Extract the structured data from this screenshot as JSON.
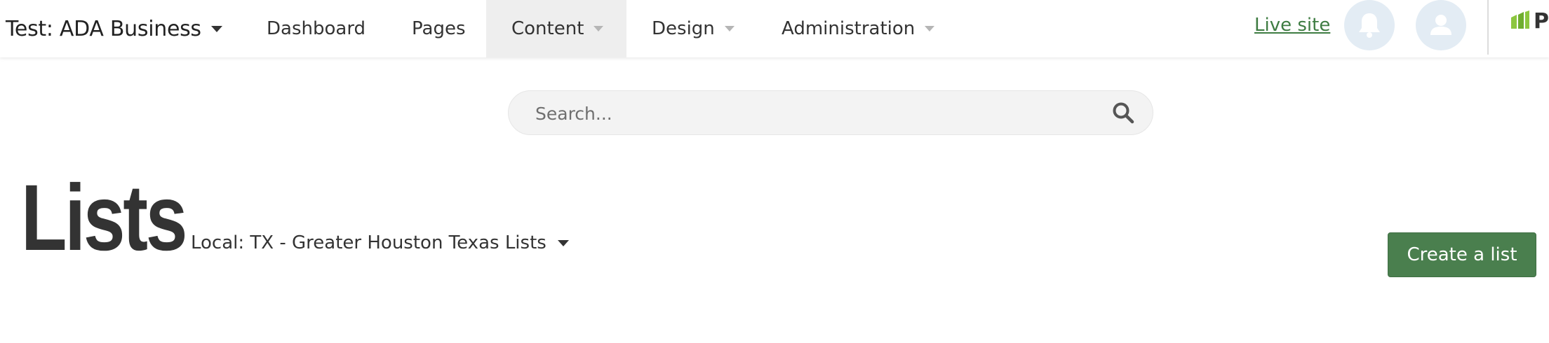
{
  "header": {
    "site_name": "Test: ADA Business",
    "nav": [
      {
        "label": "Dashboard",
        "has_dropdown": false
      },
      {
        "label": "Pages",
        "has_dropdown": false
      },
      {
        "label": "Content",
        "has_dropdown": true,
        "active": true
      },
      {
        "label": "Design",
        "has_dropdown": true
      },
      {
        "label": "Administration",
        "has_dropdown": true
      }
    ],
    "live_site": "Live site",
    "notification_icon": "bell-icon",
    "user_icon": "user-icon",
    "brand_text": "P",
    "brand_icon": "brand-logo-icon"
  },
  "search": {
    "placeholder": "Search...",
    "value": "",
    "icon": "search-icon"
  },
  "main": {
    "title": "Lists",
    "list_selector": "Local: TX - Greater Houston Texas Lists",
    "create_button": "Create a list"
  },
  "colors": {
    "accent_green": "#4a7f4e",
    "link_green": "#3e7c42",
    "icon_circle": "#e3ecf4",
    "active_nav_bg": "#eeeeee",
    "brand_green": "#8cc63f"
  }
}
